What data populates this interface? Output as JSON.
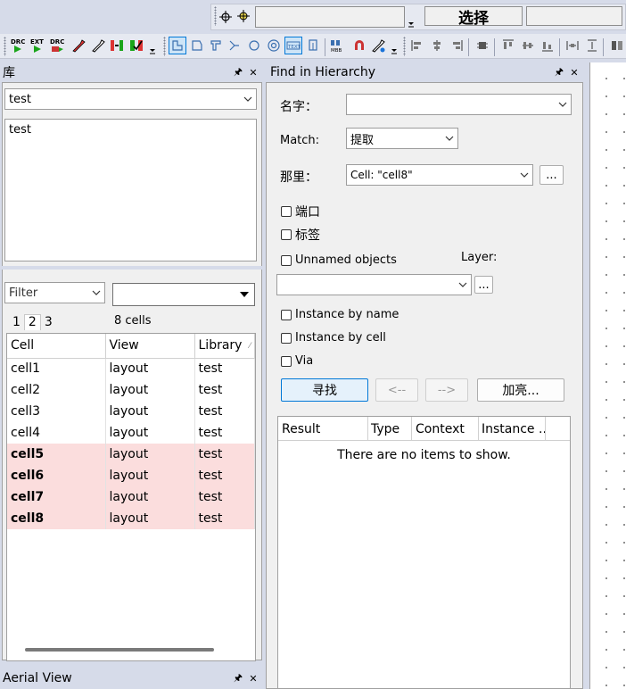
{
  "top_bar": {
    "select_label": "选择",
    "value_field": "",
    "right_field": ""
  },
  "library_panel": {
    "title": "库",
    "library_select": "test",
    "library_list": [
      "test"
    ],
    "filter_select": "Filter",
    "filter_input": "",
    "page_tabs": [
      "1",
      "2",
      "3"
    ],
    "active_page": "2",
    "cell_count": "8 cells",
    "columns": [
      "Cell",
      "View",
      "Library"
    ],
    "rows": [
      {
        "cell": "cell1",
        "view": "layout",
        "library": "test",
        "highlight": false
      },
      {
        "cell": "cell2",
        "view": "layout",
        "library": "test",
        "highlight": false
      },
      {
        "cell": "cell3",
        "view": "layout",
        "library": "test",
        "highlight": false
      },
      {
        "cell": "cell4",
        "view": "layout",
        "library": "test",
        "highlight": false
      },
      {
        "cell": "cell5",
        "view": "layout",
        "library": "test",
        "highlight": true
      },
      {
        "cell": "cell6",
        "view": "layout",
        "library": "test",
        "highlight": true
      },
      {
        "cell": "cell7",
        "view": "layout",
        "library": "test",
        "highlight": true
      },
      {
        "cell": "cell8",
        "view": "layout",
        "library": "test",
        "highlight": true
      }
    ],
    "highlight_color": "#fbdddd"
  },
  "find_panel": {
    "title": "Find in Hierarchy",
    "name_label": "名字：",
    "name_value": "",
    "match_label": "Match:",
    "match_value": "提取",
    "where_label": "那里：",
    "where_value": "Cell: \"cell8\"",
    "where_browse": "...",
    "port_label": "端口",
    "tag_label": "标签",
    "unnamed_label": "Unnamed objects",
    "layer_label": "Layer:",
    "layer_value": "",
    "layer_browse": "...",
    "instance_name_label": "Instance by name",
    "instance_cell_label": "Instance by cell",
    "via_label": "Via",
    "find_button": "寻找",
    "prev_button": "<--",
    "next_button": "-->",
    "highlight_button": "加亮...",
    "result_columns": [
      "Result",
      "Type",
      "Context",
      "Instance ..."
    ],
    "empty_message": "There are no items to show."
  },
  "aerial_panel": {
    "title": "Aerial View"
  },
  "colors": {
    "chrome": "#d6dbe9",
    "panel": "#f0f0f0",
    "accent_border": "#0078d7"
  }
}
